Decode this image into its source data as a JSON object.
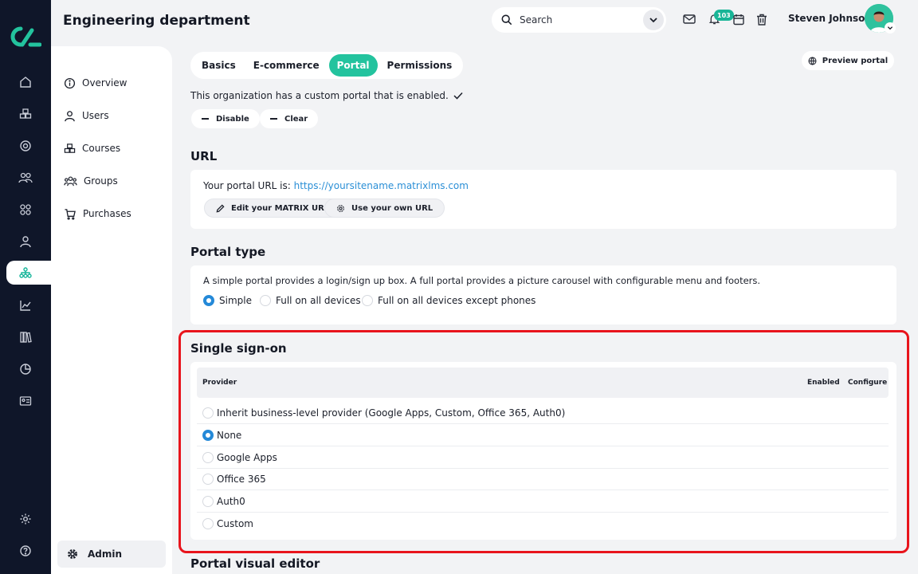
{
  "header": {
    "title": "Engineering department",
    "search_placeholder": "Search",
    "notification_count": "103",
    "user_name": "Steven Johnson"
  },
  "sidebar": {
    "items": [
      {
        "label": "Overview",
        "icon": "info-icon"
      },
      {
        "label": "Users",
        "icon": "user-icon"
      },
      {
        "label": "Courses",
        "icon": "courses-icon"
      },
      {
        "label": "Groups",
        "icon": "groups-icon"
      },
      {
        "label": "Purchases",
        "icon": "cart-icon"
      }
    ],
    "admin_label": "Admin"
  },
  "tabs": [
    "Basics",
    "E-commerce",
    "Portal",
    "Permissions"
  ],
  "active_tab": "Portal",
  "preview_label": "Preview portal",
  "portal_status": "This organization has a custom portal that is enabled.",
  "status_buttons": {
    "disable": "Disable",
    "clear": "Clear"
  },
  "url_section": {
    "title": "URL",
    "prefix": "Your portal URL is:",
    "link": "https://yoursitename.matrixlms.com",
    "edit_label": "Edit your MATRIX URL",
    "own_label": "Use your own URL"
  },
  "portal_type": {
    "title": "Portal type",
    "description": "A simple portal provides a login/sign up box. A full portal provides a picture carousel with configurable menu and footers.",
    "options": [
      "Simple",
      "Full on all devices",
      "Full on all devices except phones"
    ],
    "selected": "Simple"
  },
  "sso": {
    "title": "Single sign-on",
    "columns": {
      "provider": "Provider",
      "enabled": "Enabled",
      "configure": "Configure"
    },
    "providers": [
      "Inherit business-level provider (Google Apps, Custom, Office 365, Auth0)",
      "None",
      "Google Apps",
      "Office 365",
      "Auth0",
      "Custom"
    ],
    "selected": "None"
  },
  "next_section_title": "Portal visual editor",
  "colors": {
    "rail": "#0f1629",
    "accent": "#23c39e",
    "radio": "#2489d8",
    "highlight": "#e8141c",
    "link": "#2b8fd6"
  }
}
